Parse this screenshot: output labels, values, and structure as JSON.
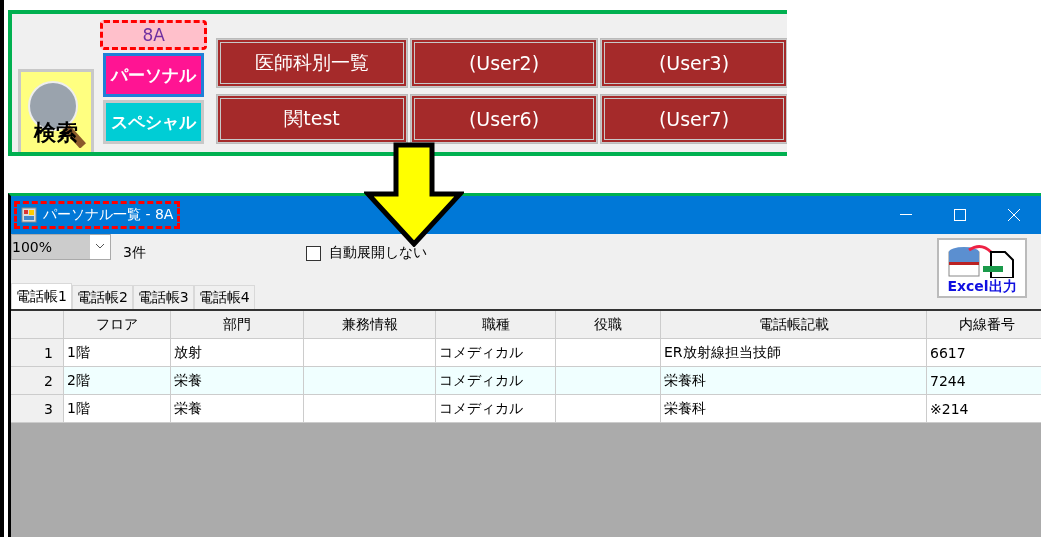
{
  "launcher": {
    "search_button": {
      "label": "検索"
    },
    "group_label": "8A",
    "mode_buttons": [
      {
        "label": "パーソナル",
        "selected": true,
        "color": "#ff1493"
      },
      {
        "label": "スペシャル",
        "selected": false,
        "color": "#00cdd5"
      }
    ],
    "list_buttons": [
      {
        "label": "医師科別一覧"
      },
      {
        "label": "(User2)"
      },
      {
        "label": "(User3)"
      },
      {
        "label": "関test"
      },
      {
        "label": "(User6)"
      },
      {
        "label": "(User7)"
      }
    ]
  },
  "window": {
    "title": "パーソナル一覧 - 8A",
    "zoom": "100%",
    "count": "3件",
    "auto_expand": {
      "label": "自動展開しない",
      "checked": false
    },
    "export_button": {
      "label": "Excel出力"
    },
    "tabs": [
      {
        "label": "電話帳1",
        "selected": true
      },
      {
        "label": "電話帳2",
        "selected": false
      },
      {
        "label": "電話帳3",
        "selected": false
      },
      {
        "label": "電話帳4",
        "selected": false
      }
    ],
    "table": {
      "columns": [
        "フロア",
        "部門",
        "兼務情報",
        "職種",
        "役職",
        "電話帳記載",
        "内線番号"
      ],
      "rows": [
        {
          "number": "1",
          "cells": [
            "1階",
            "放射",
            "",
            "コメディカル",
            "",
            "ER放射線担当技師",
            "6617"
          ],
          "selected": false
        },
        {
          "number": "2",
          "cells": [
            "2階",
            "栄養",
            "",
            "コメディカル",
            "",
            "栄養科",
            "7244"
          ],
          "selected": true
        },
        {
          "number": "3",
          "cells": [
            "1階",
            "栄養",
            "",
            "コメディカル",
            "",
            "栄養科",
            "※214"
          ],
          "selected": false
        }
      ]
    }
  }
}
